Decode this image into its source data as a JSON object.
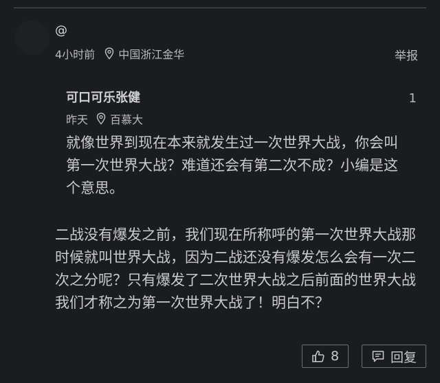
{
  "comment": {
    "username": "@",
    "time": "4小时前",
    "location": "中国浙江金华",
    "report_label": "举报",
    "text": "二战没有爆发之前，我们现在所称呼的第一次世界大战那时候就叫世界大战，因为二战还没有爆发怎么会有一次二次之分呢？只有爆发了二次世界大战之后前面的世界大战我们才称之为第一次世界大战了！明白不？",
    "icons": {
      "location": "location-pin-icon",
      "like": "thumbs-up-icon",
      "reply": "comment-bubble-icon"
    }
  },
  "quoted_reply": {
    "author": "可口可乐张健",
    "count": "1",
    "time": "昨天",
    "location": "百慕大",
    "text": "就像世界到现在本来就发生过一次世界大战，你会叫第一次世界大战？难道还会有第二次不成？小编是这个意思。"
  },
  "actions": {
    "like_count": "8",
    "reply_label": "回复"
  },
  "colors": {
    "background": "#1b1c1f",
    "text": "#c9cacc",
    "muted": "#b8b9bc",
    "border": "#6c6e73"
  }
}
